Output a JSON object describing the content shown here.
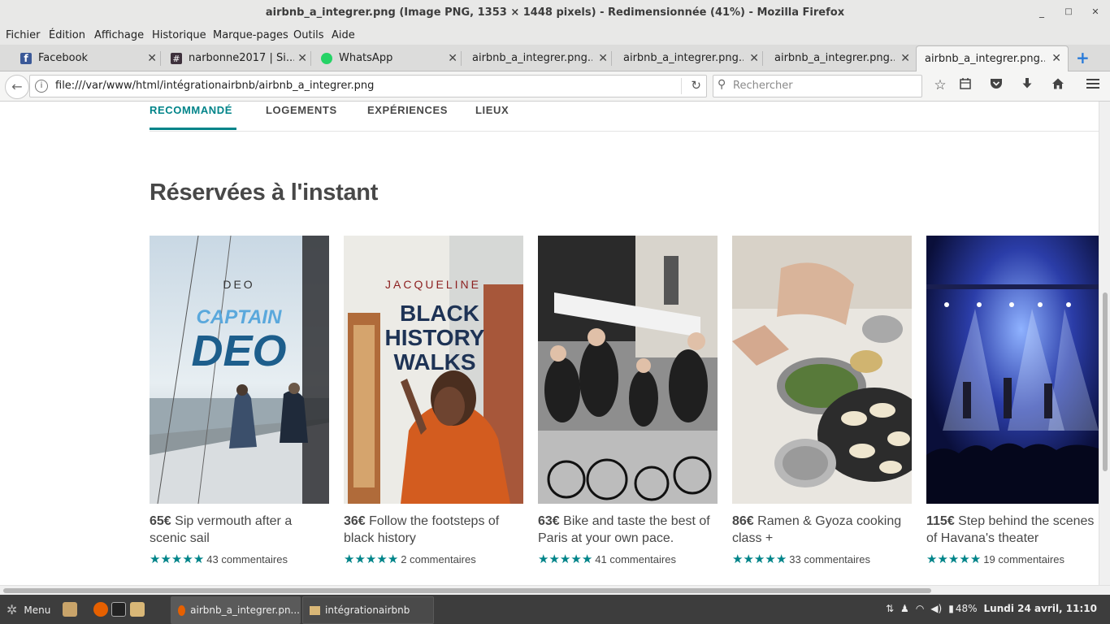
{
  "window": {
    "title": "airbnb_a_integrer.png (Image PNG, 1353 × 1448 pixels) - Redimensionnée (41%) - Mozilla Firefox",
    "minimize": "_",
    "maximize": "□",
    "close": "✕"
  },
  "menubar": [
    "Fichier",
    "Édition",
    "Affichage",
    "Historique",
    "Marque-pages",
    "Outils",
    "Aide"
  ],
  "tabs": [
    {
      "label": "Facebook",
      "icon": "facebook-icon",
      "color": "#3b5998"
    },
    {
      "label": "narbonne2017 | Si...",
      "icon": "slack-icon",
      "color": "#3e313c"
    },
    {
      "label": "WhatsApp",
      "icon": "whatsapp-icon",
      "color": "#25d366"
    },
    {
      "label": "airbnb_a_integrer.png...",
      "icon": "",
      "color": ""
    },
    {
      "label": "airbnb_a_integrer.png...",
      "icon": "",
      "color": ""
    },
    {
      "label": "airbnb_a_integrer.png...",
      "icon": "",
      "color": ""
    },
    {
      "label": "airbnb_a_integrer.png...",
      "icon": "",
      "color": "",
      "active": true
    }
  ],
  "tab_close": "✕",
  "new_tab": "+",
  "navbar": {
    "url": "file:///var/www/html/intégrationairbnb/airbnb_a_integrer.png",
    "search_placeholder": "Rechercher"
  },
  "page": {
    "subnav": [
      "RECOMMANDÉ",
      "LOGEMENTS",
      "EXPÉRIENCES",
      "LIEUX"
    ],
    "section_title": "Réservées à l'instant",
    "cards": [
      {
        "price": "65€",
        "desc": "Sip vermouth after a scenic sail",
        "rating": 5,
        "comments": "43 commentaires",
        "img_title_top": "DEO",
        "img_title_main": "CAPTAIN",
        "img_title_main2": "DEO"
      },
      {
        "price": "36€",
        "desc": "Follow the footsteps of black history",
        "rating": 5,
        "comments": "2 commentaires",
        "img_title_top": "JACQUELINE",
        "img_title_main": "BLACK",
        "img_title_main2": "HISTORY",
        "img_title_main3": "WALKS"
      },
      {
        "price": "63€",
        "desc": "Bike and taste the best of Paris at your own pace.",
        "rating": 5,
        "comments": "41 commentaires"
      },
      {
        "price": "86€",
        "desc": "Ramen & Gyoza cooking class +",
        "rating": 5,
        "comments": "33 commentaires"
      },
      {
        "price": "115€",
        "desc": "Step behind the scenes of Havana's theater",
        "rating": 5,
        "comments": "19 commentaires"
      }
    ],
    "accent_color": "#008489"
  },
  "taskbar": {
    "menu_label": "Menu",
    "tasks": [
      {
        "label": "airbnb_a_integrer.pn...",
        "active": true
      },
      {
        "label": "intégrationairbnb",
        "active": false
      }
    ],
    "battery": "48%",
    "clock": "Lundi 24 avril, 11:10"
  }
}
